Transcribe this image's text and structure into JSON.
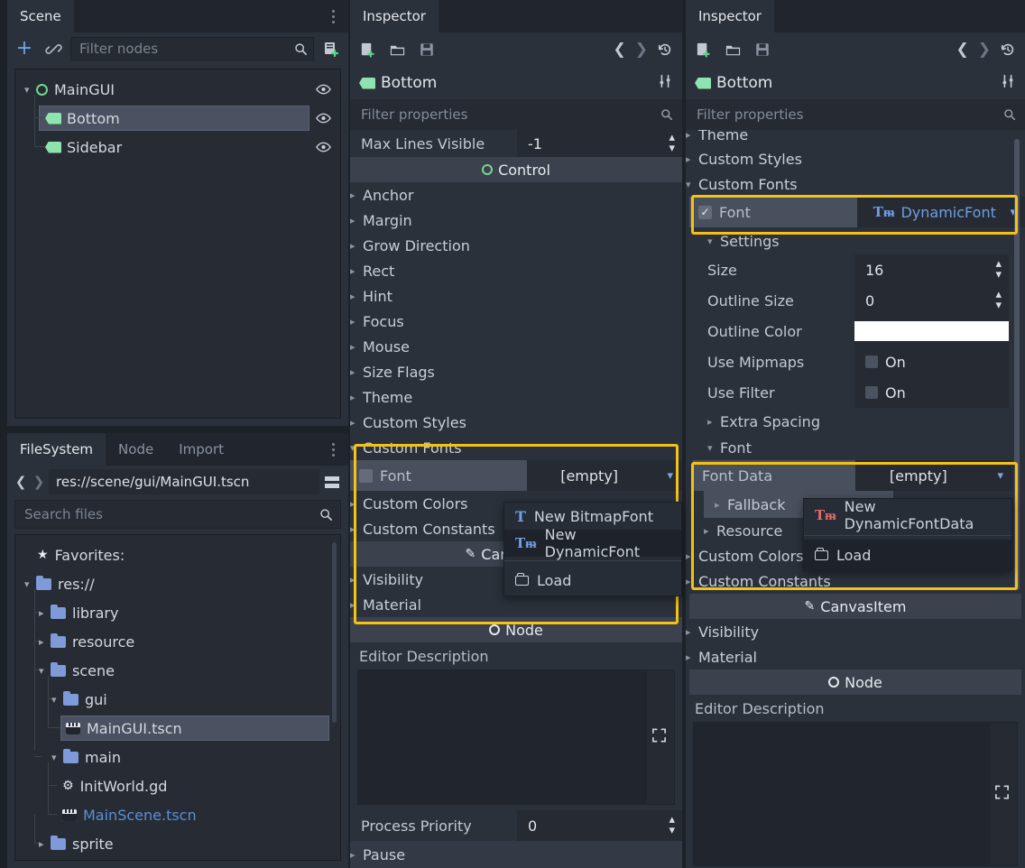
{
  "app": {
    "theme_accent": "#f5c116",
    "bg": "#1d2229",
    "panel_bg": "#2b313b"
  },
  "scene_panel": {
    "tab_label": "Scene",
    "kebab_name": "scene-menu",
    "toolbar": {
      "add_label": "+",
      "link_label": "link-icon",
      "instance_label": "instance-icon"
    },
    "filter": {
      "placeholder": "Filter nodes",
      "value": ""
    },
    "tree": [
      {
        "name": "MainGUI",
        "icon": "control-icon",
        "depth": 0,
        "expanded": true,
        "selected": false
      },
      {
        "name": "Bottom",
        "icon": "label-icon",
        "depth": 1,
        "expanded": false,
        "selected": true
      },
      {
        "name": "Sidebar",
        "icon": "label-icon",
        "depth": 1,
        "expanded": false,
        "selected": false
      }
    ]
  },
  "filesystem_panel": {
    "tabs": [
      {
        "label": "FileSystem",
        "active": true
      },
      {
        "label": "Node",
        "active": false
      },
      {
        "label": "Import",
        "active": false
      }
    ],
    "path_value": "res://scene/gui/MainGUI.tscn",
    "search": {
      "placeholder": "Search files",
      "value": ""
    },
    "tree": [
      {
        "name": "Favorites:",
        "icon": "star-icon",
        "depth": 0,
        "kind": "favorites",
        "selected": false
      },
      {
        "name": "res://",
        "icon": "folder-icon",
        "depth": 0,
        "kind": "folder",
        "expanded": true,
        "selected": false
      },
      {
        "name": "library",
        "icon": "folder-icon",
        "depth": 1,
        "kind": "folder",
        "expanded": false,
        "selected": false
      },
      {
        "name": "resource",
        "icon": "folder-icon",
        "depth": 1,
        "kind": "folder",
        "expanded": false,
        "selected": false
      },
      {
        "name": "scene",
        "icon": "folder-icon",
        "depth": 1,
        "kind": "folder",
        "expanded": true,
        "selected": false
      },
      {
        "name": "gui",
        "icon": "folder-icon",
        "depth": 2,
        "kind": "folder",
        "expanded": true,
        "selected": false
      },
      {
        "name": "MainGUI.tscn",
        "icon": "scene-icon",
        "depth": 3,
        "kind": "file",
        "selected": true
      },
      {
        "name": "main",
        "icon": "folder-icon",
        "depth": 2,
        "kind": "folder",
        "expanded": true,
        "selected": false
      },
      {
        "name": "InitWorld.gd",
        "icon": "script-icon",
        "depth": 3,
        "kind": "file",
        "selected": false
      },
      {
        "name": "MainScene.tscn",
        "icon": "scene-icon",
        "depth": 3,
        "kind": "file",
        "selected": false,
        "highlight": true
      },
      {
        "name": "sprite",
        "icon": "folder-icon",
        "depth": 1,
        "kind": "folder",
        "expanded": false,
        "selected": false
      }
    ]
  },
  "inspector_mid": {
    "tab_label": "Inspector",
    "toolbar_icons": [
      "new-resource-icon",
      "open-resource-icon",
      "save-resource-icon",
      "history-prev-icon",
      "history-next-icon",
      "history-icon"
    ],
    "node_name": "Bottom",
    "node_icon": "label-icon",
    "tools_icon": "object-tools-icon",
    "filter": {
      "placeholder": "Filter properties",
      "value": ""
    },
    "max_lines": {
      "label": "Max Lines Visible",
      "value": "-1"
    },
    "category_control": "Control",
    "groups": [
      "Anchor",
      "Margin",
      "Grow Direction",
      "Rect",
      "Hint",
      "Focus",
      "Mouse",
      "Size Flags",
      "Theme",
      "Custom Styles"
    ],
    "custom_fonts": {
      "group_label": "Custom Fonts",
      "font_label": "Font",
      "font_value": "[empty]"
    },
    "after_fonts": [
      "Custom Colors",
      "Custom Constants"
    ],
    "category_canvasitem": "CanvasItem",
    "canvas_groups": [
      "Visibility",
      "Material"
    ],
    "category_node": "Node",
    "editor_description_label": "Editor Description",
    "process_priority": {
      "label": "Process Priority",
      "value": "0"
    },
    "pause_label": "Pause",
    "menu": {
      "items": [
        {
          "label": "New BitmapFont",
          "icon": "bitmapfont-icon",
          "hover": false
        },
        {
          "label": "New DynamicFont",
          "icon": "dynamicfont-icon",
          "hover": true
        },
        {
          "label": "Load",
          "icon": "folder-open-icon",
          "hover": false,
          "after_separator": true
        }
      ]
    }
  },
  "inspector_right": {
    "tab_label": "Inspector",
    "node_name": "Bottom",
    "node_icon": "label-icon",
    "filter": {
      "placeholder": "Filter properties",
      "value": ""
    },
    "top_groups": [
      "Theme",
      "Custom Styles"
    ],
    "custom_fonts_label": "Custom Fonts",
    "font_row": {
      "label": "Font",
      "value": "DynamicFont",
      "checked": true
    },
    "settings_label": "Settings",
    "settings": [
      {
        "label": "Size",
        "value": "16",
        "type": "spin"
      },
      {
        "label": "Outline Size",
        "value": "0",
        "type": "spin"
      },
      {
        "label": "Outline Color",
        "value": "#ffffff",
        "type": "color"
      },
      {
        "label": "Use Mipmaps",
        "value": "On",
        "type": "checkbox"
      },
      {
        "label": "Use Filter",
        "value": "On",
        "type": "checkbox"
      }
    ],
    "extra_spacing_label": "Extra Spacing",
    "font_group_label": "Font",
    "font_data": {
      "label": "Font Data",
      "value": "[empty]"
    },
    "sub_groups": [
      "Fallback",
      "Resource"
    ],
    "after_groups": [
      "Custom Colors",
      "Custom Constants"
    ],
    "category_canvasitem": "CanvasItem",
    "canvas_groups": [
      "Visibility",
      "Material"
    ],
    "category_node": "Node",
    "editor_description_label": "Editor Description",
    "menu": {
      "items": [
        {
          "label": "New DynamicFontData",
          "icon": "dynamicfontdata-icon",
          "hover": false
        },
        {
          "label": "Load",
          "icon": "folder-open-icon",
          "hover": true,
          "after_separator": true
        }
      ]
    }
  }
}
